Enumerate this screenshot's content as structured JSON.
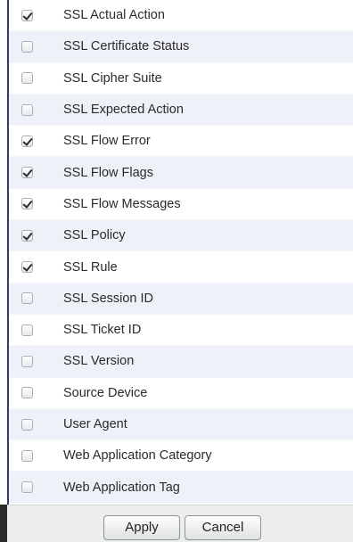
{
  "columns": [
    {
      "label": "SSL Actual Action",
      "checked": true
    },
    {
      "label": "SSL Certificate Status",
      "checked": false
    },
    {
      "label": "SSL Cipher Suite",
      "checked": false
    },
    {
      "label": "SSL Expected Action",
      "checked": false
    },
    {
      "label": "SSL Flow Error",
      "checked": true
    },
    {
      "label": "SSL Flow Flags",
      "checked": true
    },
    {
      "label": "SSL Flow Messages",
      "checked": true
    },
    {
      "label": "SSL Policy",
      "checked": true
    },
    {
      "label": "SSL Rule",
      "checked": true
    },
    {
      "label": "SSL Session ID",
      "checked": false
    },
    {
      "label": "SSL Ticket ID",
      "checked": false
    },
    {
      "label": "SSL Version",
      "checked": false
    },
    {
      "label": "Source Device",
      "checked": false
    },
    {
      "label": "User Agent",
      "checked": false
    },
    {
      "label": "Web Application Category",
      "checked": false
    },
    {
      "label": "Web Application Tag",
      "checked": false
    }
  ],
  "footer": {
    "apply_label": "Apply",
    "cancel_label": "Cancel"
  },
  "colors": {
    "row_alt": "#eef1f8",
    "row_white": "#ffffff",
    "left_rule": "#2f3c63",
    "footer_bg": "#eceeee"
  }
}
